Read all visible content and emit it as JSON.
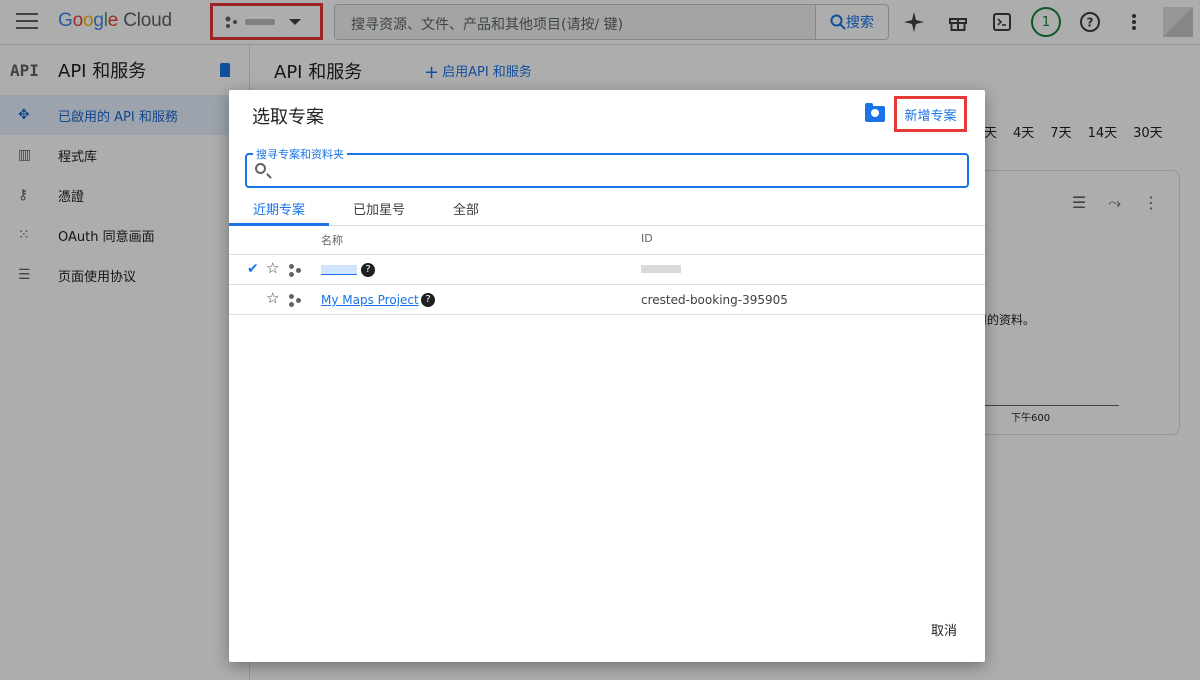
{
  "header": {
    "logo": {
      "g": "G",
      "o1": "o",
      "o2": "o",
      "g2": "g",
      "l": "l",
      "e": "e",
      "cloud": "Cloud"
    },
    "search_placeholder": "搜寻资源、文件、产品和其他项目(请按/ 键)",
    "search_button": "搜索",
    "notification_count": "1",
    "icons": [
      "menu-icon",
      "sparkle-icon",
      "gift-icon",
      "terminal-icon",
      "help-icon",
      "more-vert-icon"
    ]
  },
  "sidebar": {
    "logo": "API",
    "title": "API 和服务",
    "items": [
      {
        "label": "已啟用的 API 和服務",
        "icon": "diamond-icon",
        "active": true
      },
      {
        "label": "程式库",
        "icon": "library-icon",
        "active": false
      },
      {
        "label": "憑證",
        "icon": "key-icon",
        "active": false
      },
      {
        "label": "OAuth 同意画面",
        "icon": "oauth-icon",
        "active": false
      },
      {
        "label": "页面使用协议",
        "icon": "settings-list-icon",
        "active": false
      }
    ]
  },
  "main": {
    "title": "API 和服务",
    "enable_api": "启用API 和服务",
    "time_ranges": [
      "天",
      "4天",
      "7天",
      "14天",
      "30天"
    ],
    "card_text": "用的资料。",
    "axis_label": "下午600"
  },
  "dialog": {
    "title": "选取专案",
    "new_project": "新增专案",
    "search_label": "搜寻专案和资料夹",
    "tabs": [
      "近期专案",
      "已加星号",
      "全部"
    ],
    "columns": {
      "name": "名称",
      "id": "ID"
    },
    "rows": [
      {
        "name": "",
        "id": "",
        "selected": true
      },
      {
        "name": "My Maps Project",
        "id": "crested-booking-395905",
        "selected": false
      }
    ],
    "cancel": "取消"
  },
  "colors": {
    "accent": "#1a73e8",
    "highlight_box": "#e53935"
  }
}
